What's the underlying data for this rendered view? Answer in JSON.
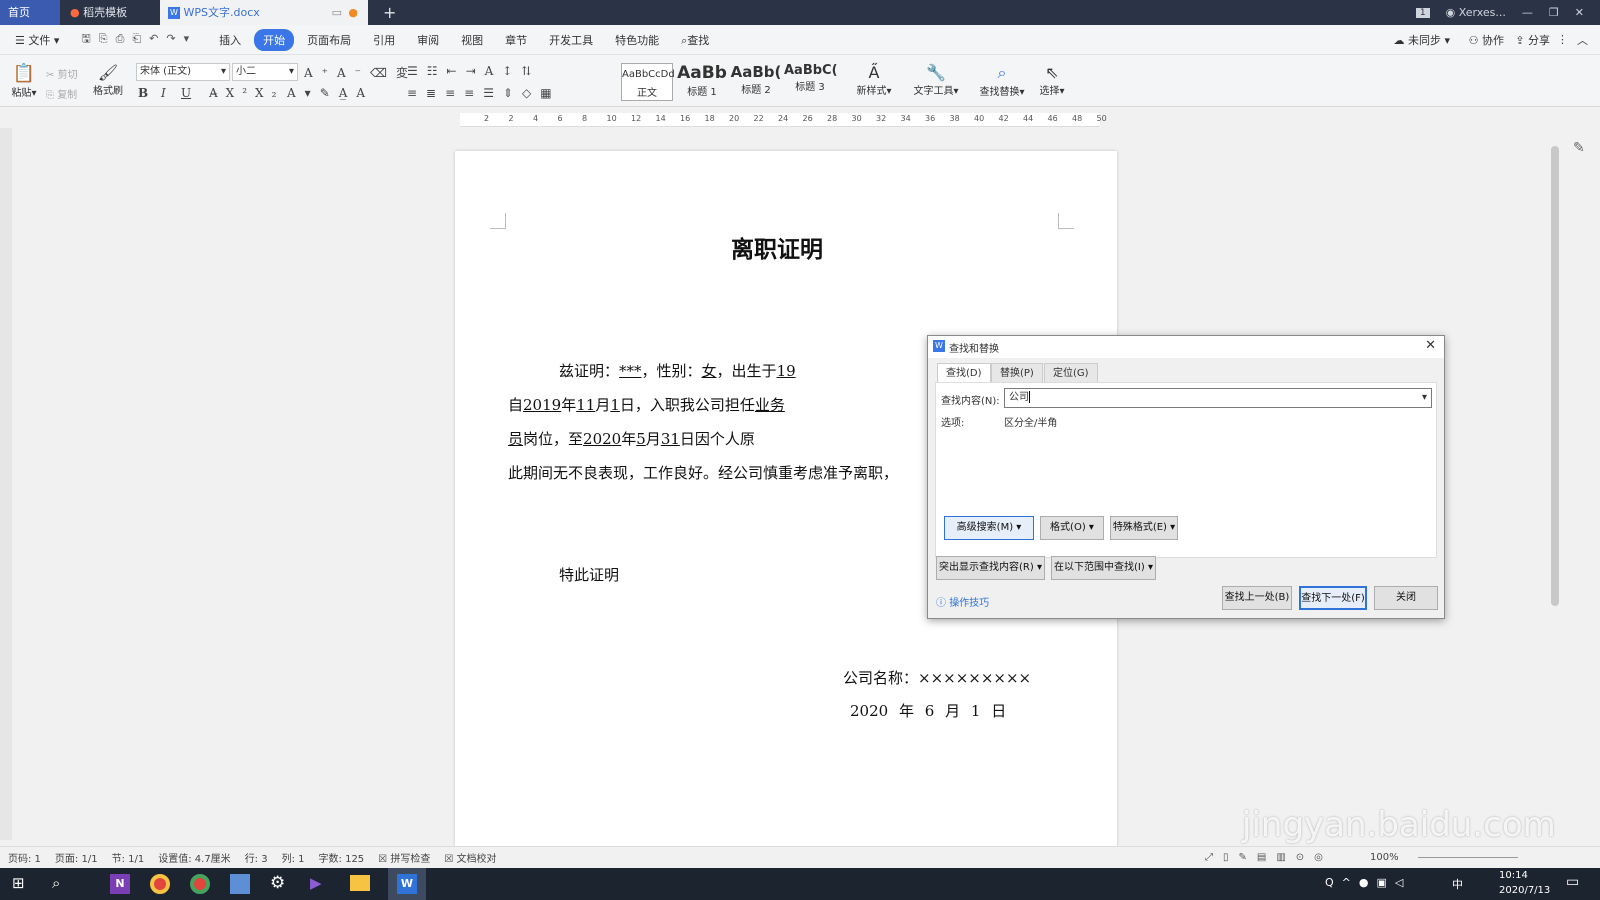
{
  "titlebar": {
    "tabs": [
      "首页",
      "稻壳模板",
      "WPS文字.docx"
    ],
    "new_tab": "+",
    "page_badge": "1",
    "user": "Xerxes..."
  },
  "menubar": {
    "file": "文件",
    "items": [
      "插入",
      "开始",
      "页面布局",
      "引用",
      "审阅",
      "视图",
      "章节",
      "开发工具",
      "特色功能",
      "查找"
    ],
    "sync": "未同步",
    "collab": "协作",
    "share": "分享"
  },
  "ribbon": {
    "paste": "粘贴",
    "cut": "剪切",
    "copy": "复制",
    "format_painter": "格式刷",
    "font_name": "宋体 (正文)",
    "font_size": "小二",
    "styles": [
      {
        "preview": "AaBbCcDd",
        "name": "正文"
      },
      {
        "preview": "AaBb",
        "name": "标题 1"
      },
      {
        "preview": "AaBb(",
        "name": "标题 2"
      },
      {
        "preview": "AaBbC(",
        "name": "标题 3"
      }
    ],
    "new_style": "新样式",
    "text_tools": "文字工具",
    "find_replace": "查找替换",
    "select": "选择"
  },
  "ruler": {
    "h_ticks": [
      "2",
      "2",
      "4",
      "6",
      "8",
      "10",
      "12",
      "14",
      "16",
      "18",
      "20",
      "22",
      "24",
      "26",
      "28",
      "30",
      "32",
      "34",
      "36",
      "38",
      "40",
      "42",
      "44",
      "46",
      "48",
      "50"
    ]
  },
  "document": {
    "title": "离职证明",
    "p1": {
      "a": "兹证明：",
      "name": "***",
      "b": "，性别：",
      "gender": "女",
      "c": "，出生于",
      "d": "19"
    },
    "p2": {
      "a": "自",
      "y": "2019",
      "b": "年",
      "m": "11",
      "c": "月",
      "d": "1",
      "e": "日，入职我公司担任",
      "f": "业务"
    },
    "p3": {
      "a": "员",
      "b": "岗位",
      "c": "，至",
      "y": "2020",
      "d": "年",
      "m": "5",
      "e": "月",
      "day": "31",
      "f": "日因个人原"
    },
    "p4": "此期间无不良表现，工作良好。经公司慎重考虑准予离职，",
    "closing": "特此证明",
    "company": "公司名称：×××××××××",
    "date": {
      "y": "2020",
      "yl": "年",
      "m": "6",
      "ml": "月",
      "d": "1",
      "dl": "日"
    }
  },
  "dialog": {
    "title": "查找和替换",
    "tabs": [
      "查找(D)",
      "替换(P)",
      "定位(G)"
    ],
    "find_label": "查找内容(N):",
    "find_value": "公司",
    "options_label": "选项:",
    "options_value": "区分全/半角",
    "advanced": "高级搜索(M)",
    "format": "格式(O)",
    "special": "特殊格式(E)",
    "highlight": "突出显示查找内容(R)",
    "find_in": "在以下范围中查找(I)",
    "tips": "操作技巧",
    "prev": "查找上一处(B)",
    "next": "查找下一处(F)",
    "close": "关闭"
  },
  "statusbar": {
    "page_no": "页码: 1",
    "pages": "页面: 1/1",
    "section": "节: 1/1",
    "setting": "设置值: 4.7厘米",
    "row": "行: 3",
    "col": "列: 1",
    "words": "字数: 125",
    "spell": "拼写检查",
    "proof": "文档校对",
    "zoom": "100%"
  },
  "taskbar": {
    "time": "10:14",
    "date": "2020/7/13",
    "ime": "中"
  },
  "watermark": "jingyan.baidu.com",
  "colors": {
    "accent": "#3a76e8",
    "titlebar": "#2b3346",
    "taskbar": "#1c2430"
  }
}
